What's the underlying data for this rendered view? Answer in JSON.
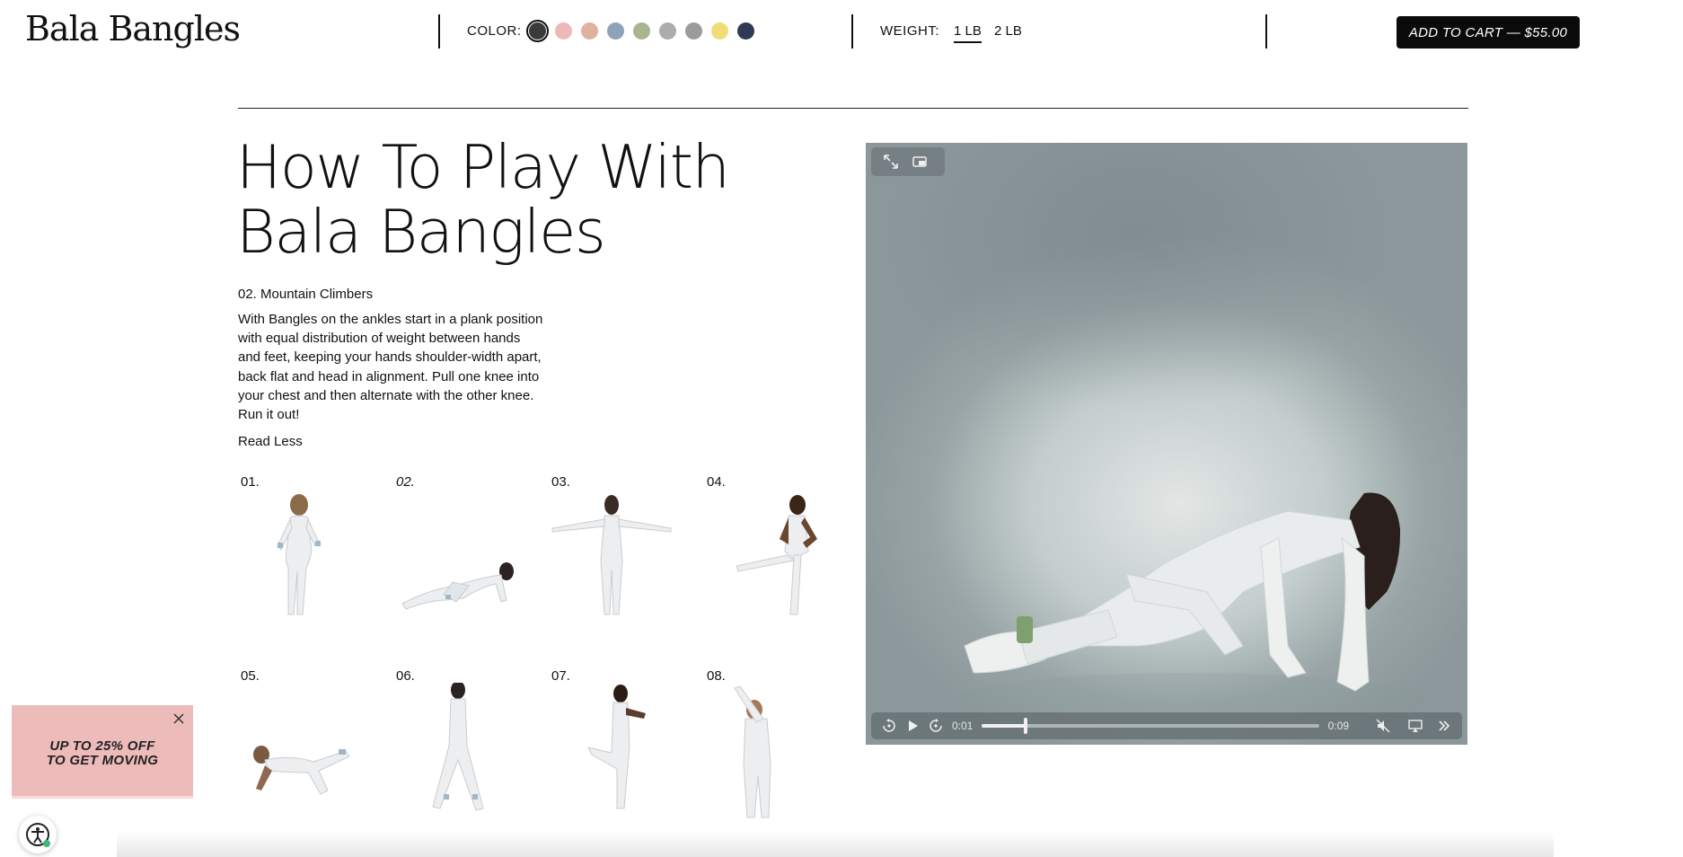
{
  "brand": {
    "logo_text": "Bala Bangles"
  },
  "options": {
    "color_label": "COLOR:",
    "swatches": [
      {
        "name": "charcoal",
        "color": "#3a3a3a",
        "selected": true
      },
      {
        "name": "pink",
        "color": "#ecb8b8",
        "selected": false
      },
      {
        "name": "sand",
        "color": "#dfb1a0",
        "selected": false
      },
      {
        "name": "slate-blue",
        "color": "#8da3b8",
        "selected": false
      },
      {
        "name": "sage",
        "color": "#a8b590",
        "selected": false
      },
      {
        "name": "grey",
        "color": "#aaacae",
        "selected": false
      },
      {
        "name": "marble",
        "color": "#9b9b9b",
        "selected": false
      },
      {
        "name": "yellow",
        "color": "#f2dc78",
        "selected": false
      },
      {
        "name": "navy-moon",
        "color": "#2f3b55",
        "selected": false
      }
    ],
    "weight_label": "WEIGHT:",
    "weights": [
      {
        "label": "1 LB",
        "active": true
      },
      {
        "label": "2 LB",
        "active": false
      }
    ],
    "cart_label": "ADD TO CART — $55.00"
  },
  "content": {
    "title_line1": "How To Play With",
    "title_line2": "Bala Bangles",
    "subtitle": "02. Mountain Climbers",
    "description": "With Bangles on the ankles start in a plank position with equal distribution of weight between hands and feet, keeping your hands shoulder-width apart, back flat and head in alignment. Pull one knee into your chest and then alternate with the other knee. Run it out!",
    "read_less": "Read Less",
    "exercises": [
      {
        "num": "01.",
        "active": false
      },
      {
        "num": "02.",
        "active": true
      },
      {
        "num": "03.",
        "active": false
      },
      {
        "num": "04.",
        "active": false
      },
      {
        "num": "05.",
        "active": false
      },
      {
        "num": "06.",
        "active": false
      },
      {
        "num": "07.",
        "active": false
      },
      {
        "num": "08.",
        "active": false
      }
    ]
  },
  "video": {
    "current_time": "0:01",
    "duration": "0:09",
    "progress_fraction": 0.13
  },
  "promo": {
    "line1": "UP TO 25% OFF",
    "line2": "TO GET MOVING"
  },
  "icons": {
    "expand": "expand-icon",
    "pip": "picture-in-picture-icon",
    "rewind": "rewind-icon",
    "play": "play-icon",
    "forward": "forward-icon",
    "mute": "mute-icon",
    "airplay": "airplay-icon",
    "more": "more-icon",
    "close": "close-icon",
    "accessibility": "accessibility-icon"
  }
}
